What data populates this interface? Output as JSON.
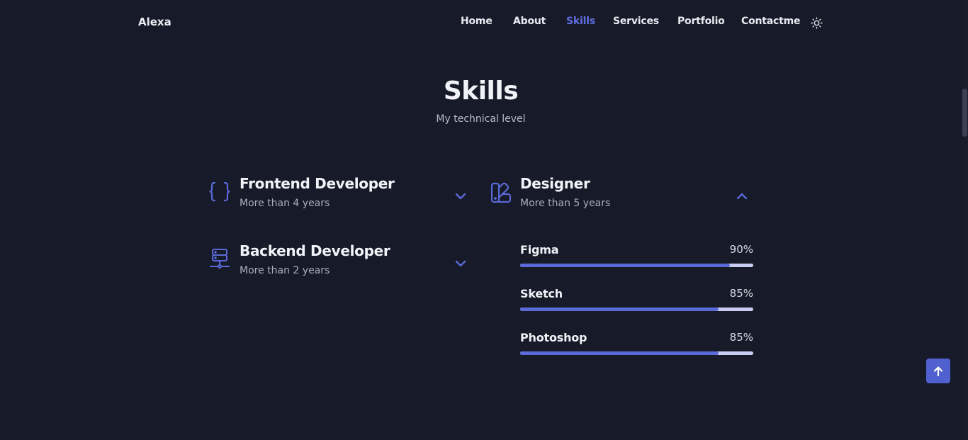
{
  "header": {
    "logo": "Alexa",
    "nav": [
      {
        "label": "Home",
        "active": false
      },
      {
        "label": "About",
        "active": false
      },
      {
        "label": "Skills",
        "active": true
      },
      {
        "label": "Services",
        "active": false
      },
      {
        "label": "Portfolio",
        "active": false
      },
      {
        "label": "Contactme",
        "active": false
      }
    ],
    "theme_icon": "sun-icon"
  },
  "section": {
    "title": "Skills",
    "subtitle": "My technical level"
  },
  "skills": {
    "frontend": {
      "title": "Frontend Developer",
      "subtitle": "More than 4 years",
      "icon": "code-braces-icon",
      "expanded": false
    },
    "backend": {
      "title": "Backend Developer",
      "subtitle": "More than 2 years",
      "icon": "server-icon",
      "expanded": false
    },
    "designer": {
      "title": "Designer",
      "subtitle": "More than 5 years",
      "icon": "swatchbook-icon",
      "expanded": true,
      "items": [
        {
          "name": "Figma",
          "percent_label": "90%",
          "percent": 90
        },
        {
          "name": "Sketch",
          "percent_label": "85%",
          "percent": 85
        },
        {
          "name": "Photoshop",
          "percent_label": "85%",
          "percent": 85
        }
      ]
    }
  },
  "colors": {
    "background": "#171a28",
    "accent": "#5a6ad8",
    "bar_track": "#c9cdf4"
  },
  "scroll_top_icon": "arrow-up-icon"
}
